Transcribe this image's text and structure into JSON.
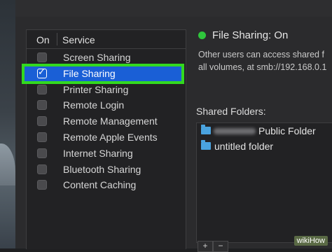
{
  "services": {
    "header_on": "On",
    "header_service": "Service",
    "items": [
      {
        "label": "Screen Sharing",
        "checked": false,
        "selected": false
      },
      {
        "label": "File Sharing",
        "checked": true,
        "selected": true
      },
      {
        "label": "Printer Sharing",
        "checked": false,
        "selected": false
      },
      {
        "label": "Remote Login",
        "checked": false,
        "selected": false
      },
      {
        "label": "Remote Management",
        "checked": false,
        "selected": false
      },
      {
        "label": "Remote Apple Events",
        "checked": false,
        "selected": false
      },
      {
        "label": "Internet Sharing",
        "checked": false,
        "selected": false
      },
      {
        "label": "Bluetooth Sharing",
        "checked": false,
        "selected": false
      },
      {
        "label": "Content Caching",
        "checked": false,
        "selected": false
      }
    ]
  },
  "status": {
    "title": "File Sharing: On",
    "line1": "Other users can access shared f",
    "line2": "all volumes, at smb://192.168.0.1",
    "indicator_color": "#2fc53c"
  },
  "shared_folders": {
    "title": "Shared Folders:",
    "items": [
      {
        "label": "Public Folder",
        "icon": "folder-icon"
      },
      {
        "label": "untitled folder",
        "icon": "folder-icon"
      }
    ],
    "add_label": "+",
    "remove_label": "−"
  },
  "watermark": "wikiHow",
  "colors": {
    "selection": "#1a5fd6",
    "highlight_outline": "#33d91f",
    "folder": "#4aa3df"
  }
}
